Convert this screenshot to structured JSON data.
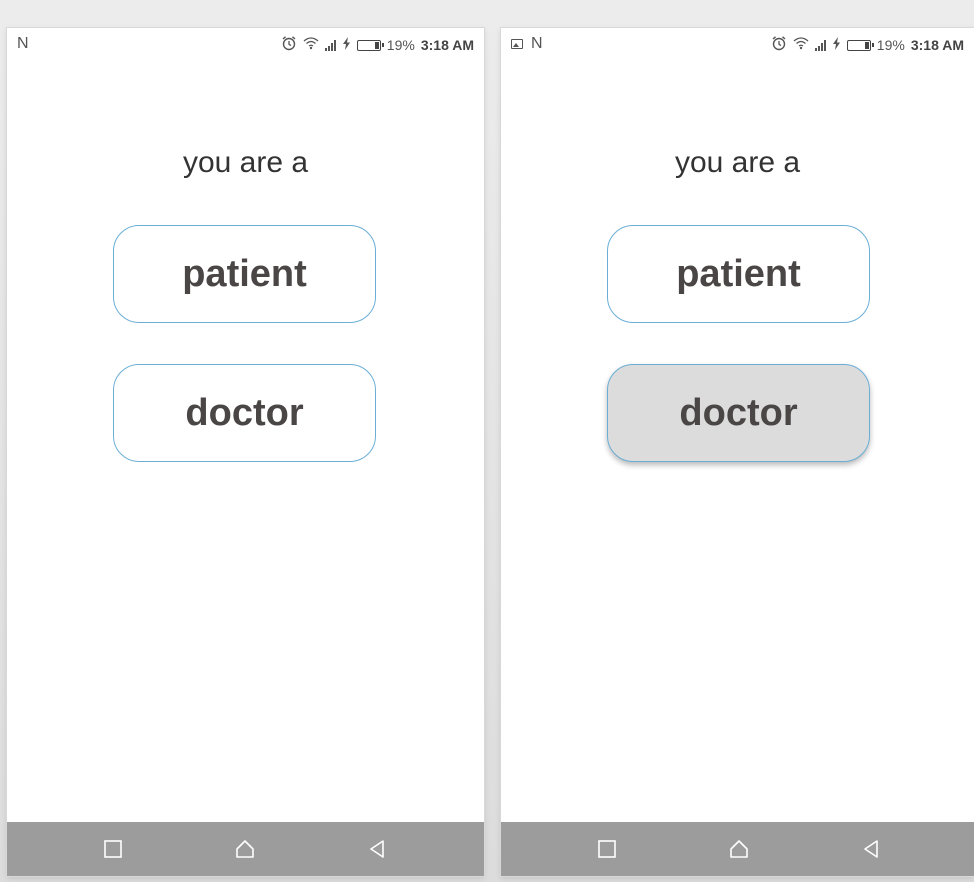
{
  "screens": [
    {
      "status": {
        "carrier_letter": "N",
        "battery_pct": "19%",
        "time": "3:18 AM"
      },
      "prompt": "you are a",
      "buttons": {
        "patient": "patient",
        "doctor": "doctor"
      },
      "pressed": null
    },
    {
      "status": {
        "carrier_letter": "N",
        "battery_pct": "19%",
        "time": "3:18 AM"
      },
      "prompt": "you are a",
      "buttons": {
        "patient": "patient",
        "doctor": "doctor"
      },
      "pressed": "doctor"
    }
  ],
  "colors": {
    "button_border": "#6aaed6",
    "button_text": "#4a4646",
    "pressed_bg": "#dcdcdc",
    "nav_bar": "#9c9c9c"
  },
  "icons": {
    "status": [
      "alarm-icon",
      "wifi-icon",
      "signal-icon",
      "charging-icon",
      "battery-icon"
    ],
    "nav": [
      "recent-apps-icon",
      "home-icon",
      "back-icon"
    ]
  }
}
